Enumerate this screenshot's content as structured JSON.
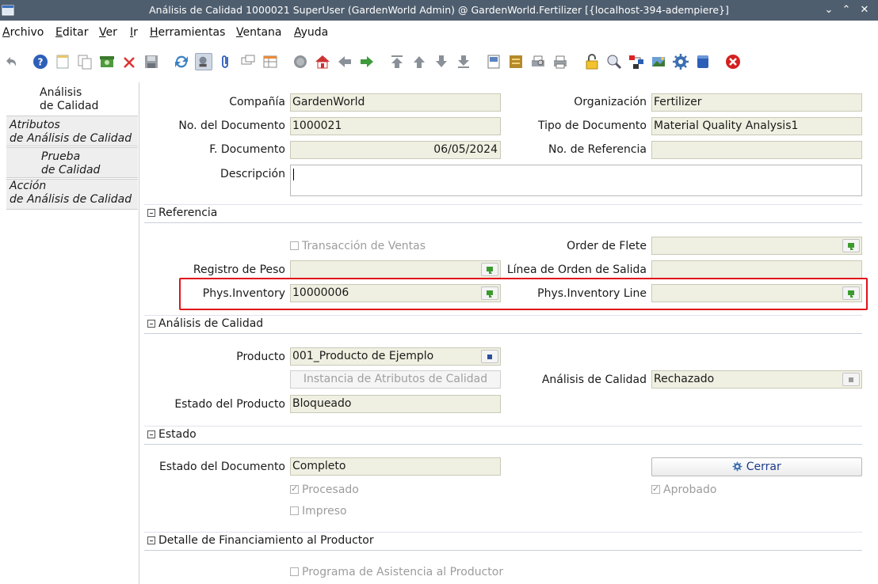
{
  "window": {
    "title": "Análisis de Calidad 1000021 SuperUser (GardenWorld Admin) @ GardenWorld.Fertilizer [{localhost-394-adempiere}]"
  },
  "menu": {
    "items": [
      {
        "first": "A",
        "rest": "rchivo"
      },
      {
        "first": "E",
        "rest": "ditar"
      },
      {
        "first": "V",
        "rest": "er"
      },
      {
        "first": "I",
        "rest": "r"
      },
      {
        "first": "H",
        "rest": "erramientas"
      },
      {
        "first": "V",
        "rest": "entana"
      },
      {
        "first": "A",
        "rest": "yuda"
      }
    ]
  },
  "tabs": {
    "selected": {
      "line1": "Análisis",
      "line2": "de Calidad"
    },
    "attributes": {
      "line1": "Atributos",
      "line2": "de Análisis de Calidad"
    },
    "test": {
      "line1": "Prueba",
      "line2": "de Calidad"
    },
    "action": {
      "line1": "Acción",
      "line2": "de Análisis de Calidad"
    }
  },
  "header": {
    "company_label": "Compañía",
    "company_value": "GardenWorld",
    "org_label": "Organización",
    "org_value": "Fertilizer",
    "docno_label": "No. del Documento",
    "docno_value": "1000021",
    "doctype_label": "Tipo de Documento",
    "doctype_value": "Material Quality Analysis1",
    "docdate_label": "F. Documento",
    "docdate_value": "06/05/2024",
    "refno_label": "No. de Referencia",
    "refno_value": "",
    "desc_label": "Descripción",
    "desc_value": ""
  },
  "referencia": {
    "title": "Referencia",
    "sales_tx_label": "Transacción de Ventas",
    "freight_order_label": "Order de Flete",
    "freight_order_value": "",
    "weight_reg_label": "Registro de Peso",
    "weight_reg_value": "",
    "outbound_line_label": "Línea de Orden de Salida",
    "outbound_line_value": "",
    "phys_inv_label": "Phys.Inventory",
    "phys_inv_value": "10000006",
    "phys_inv_line_label": "Phys.Inventory Line",
    "phys_inv_line_value": ""
  },
  "analisis": {
    "title": "Análisis de Calidad",
    "product_label": "Producto",
    "product_value": "001_Producto de Ejemplo",
    "attr_instance_label": "Instancia de Atributos de Calidad",
    "quality_label": "Análisis de Calidad",
    "quality_value": "Rechazado",
    "product_status_label": "Estado del Producto",
    "product_status_value": "Bloqueado"
  },
  "estado": {
    "title": "Estado",
    "doc_status_label": "Estado del Documento",
    "doc_status_value": "Completo",
    "close_button": "Cerrar",
    "processed_label": "Procesado",
    "approved_label": "Aprobado",
    "printed_label": "Impreso"
  },
  "financiamiento": {
    "title": "Detalle de Financiamiento al Productor",
    "program_label": "Programa de Asistencia al Productor"
  }
}
